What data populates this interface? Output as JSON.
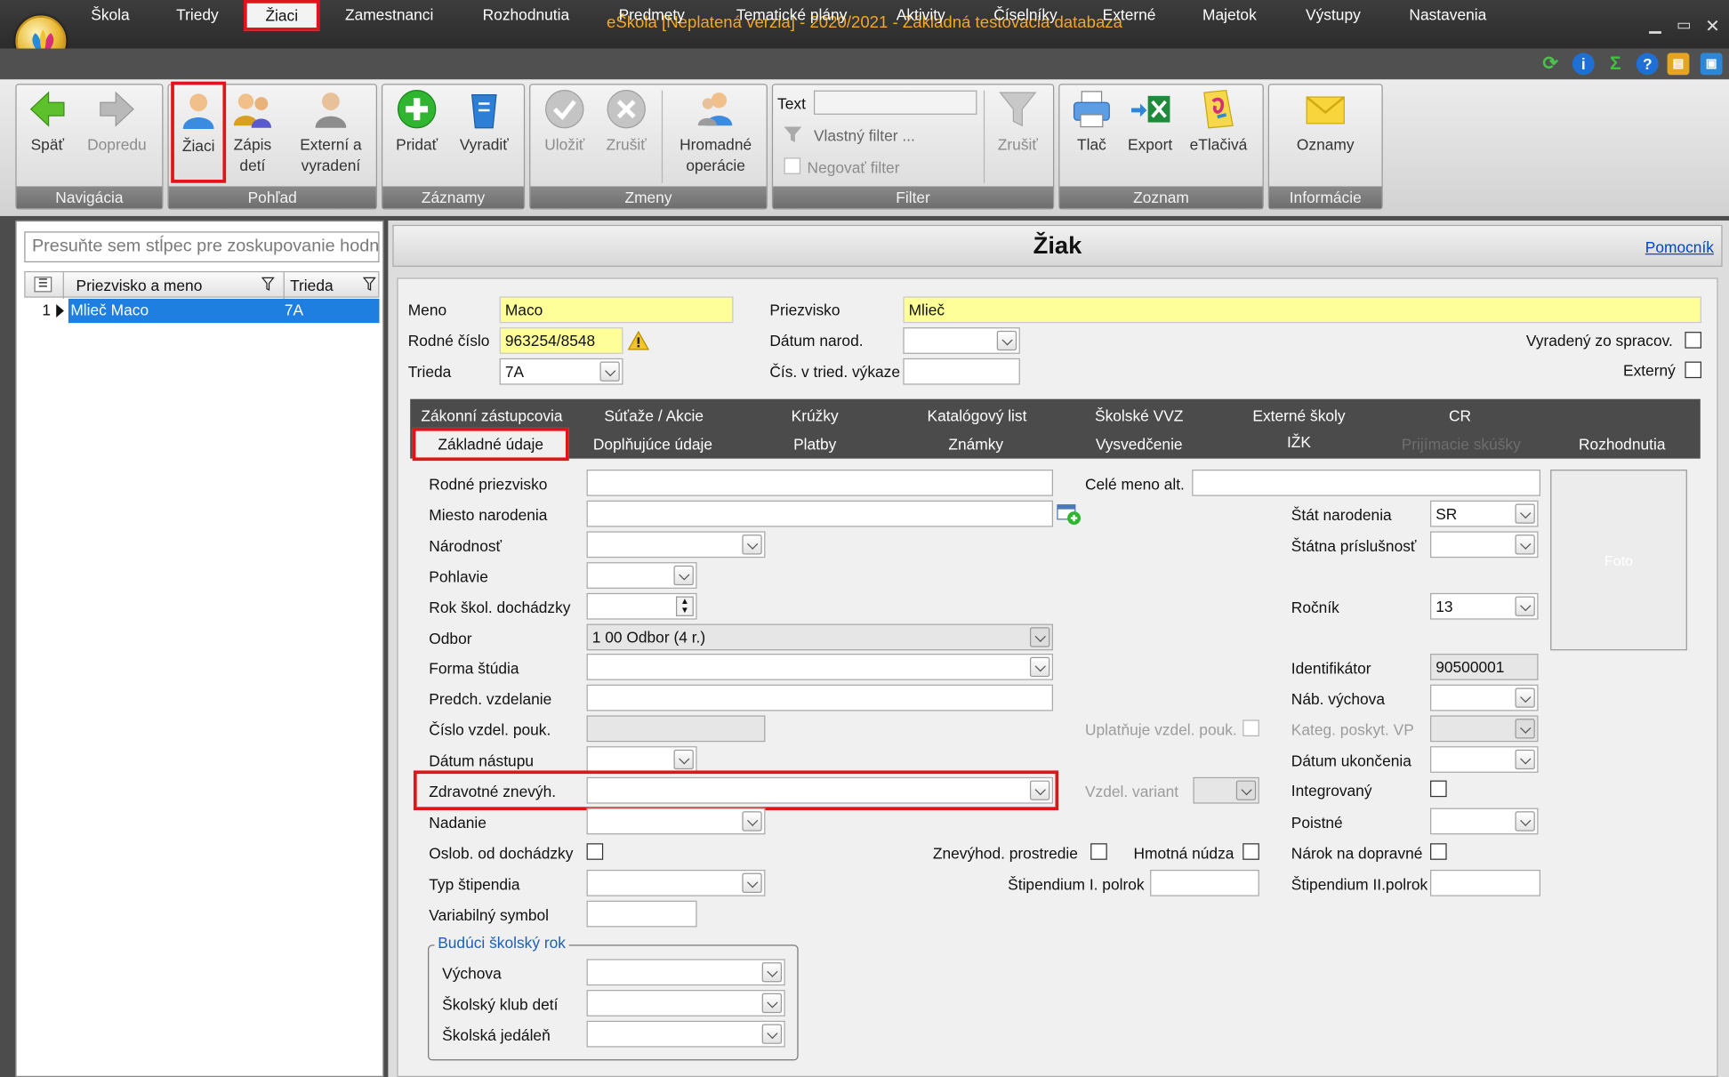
{
  "window": {
    "title": "eŠkola [Neplatená verzia] - 2020/2021 - Základná testovacia databaza"
  },
  "menu": [
    "Škola",
    "Triedy",
    "Žiaci",
    "Zamestnanci",
    "Rozhodnutia",
    "Predmety",
    "Tematické plány",
    "Aktivity",
    "Číselníky",
    "Externé",
    "Majetok",
    "Výstupy",
    "Nastavenia"
  ],
  "ribbon": {
    "nav": {
      "back": "Späť",
      "forward": "Dopredu",
      "group": "Navigácia"
    },
    "view": {
      "students": "Žiaci",
      "enroll_line1": "Zápis",
      "enroll_line2": "detí",
      "ext_line1": "Externí a",
      "ext_line2": "vyradení",
      "group": "Pohľad"
    },
    "records": {
      "add": "Pridať",
      "discard": "Vyradiť",
      "group": "Záznamy"
    },
    "changes": {
      "save": "Uložiť",
      "cancel": "Zrušiť",
      "bulk_line1": "Hromadné",
      "bulk_line2": "operácie",
      "group": "Zmeny"
    },
    "filter": {
      "text_label": "Text",
      "custom": "Vlastný filter ...",
      "negate": "Negovať filter",
      "clear": "Zrušiť",
      "group": "Filter"
    },
    "list": {
      "print": "Tlač",
      "export": "Export",
      "eprint": "eTlačivá",
      "group": "Zoznam"
    },
    "info": {
      "announce": "Oznamy",
      "group": "Informácie"
    }
  },
  "grid": {
    "group_hint": "Presuňte sem stĺpec pre zoskupovanie hodnôt",
    "col_name": "Priezvisko a meno",
    "col_class": "Trieda",
    "rows": [
      {
        "num": "1",
        "name": "Mlieč Maco",
        "class": "7A"
      }
    ]
  },
  "detail": {
    "title": "Žiak",
    "help": "Pomocník",
    "meno_label": "Meno",
    "meno": "Maco",
    "priezvisko_label": "Priezvisko",
    "priezvisko": "Mlieč",
    "rc_label": "Rodné číslo",
    "rc": "963254/8548",
    "datum_label": "Dátum narod.",
    "trieda_label": "Trieda",
    "trieda": "7A",
    "cis_label": "Čís. v tried. výkaze",
    "vyradeny_label": "Vyradený zo spracov.",
    "externy_label": "Externý"
  },
  "tabs_row1": [
    "Zákonní zástupcovia",
    "Súťaže / Akcie",
    "Krúžky",
    "Katalógový list",
    "Školské VVZ",
    "Externé školy",
    "CR"
  ],
  "tabs_row2": [
    "Základné údaje",
    "Doplňujúce údaje",
    "Platby",
    "Známky",
    "Vysvedčenie",
    "IŽK",
    "Prijímacie skúšky",
    "Rozhodnutia"
  ],
  "basic": {
    "rodne_priezvisko": "Rodné priezvisko",
    "cele_meno_alt": "Celé meno alt.",
    "miesto_narodenia": "Miesto narodenia",
    "stat_narodenia": "Štát narodenia",
    "stat_narodenia_val": "SR",
    "narodnost": "Národnosť",
    "statna_prislusnost": "Štátna príslušnosť",
    "pohlavie": "Pohlavie",
    "rok_skol": "Rok škol. dochádzky",
    "rocnik": "Ročník",
    "rocnik_val": "13",
    "odbor": "Odbor",
    "odbor_val": "1 00 Odbor (4 r.)",
    "forma": "Forma štúdia",
    "identifikator": "Identifikátor",
    "identifikator_val": "90500001",
    "predch": "Predch. vzdelanie",
    "nab_vychova": "Náb. výchova",
    "cislo_pouk": "Číslo vzdel. pouk.",
    "uplatnuje": "Uplatňuje vzdel. pouk.",
    "kateg": "Kateg. poskyt. VP",
    "datum_nastupu": "Dátum nástupu",
    "datum_ukoncenia": "Dátum ukončenia",
    "zdravotne": "Zdravotné znevýh.",
    "vzdel_variant": "Vzdel. variant",
    "integrovany": "Integrovaný",
    "nadanie": "Nadanie",
    "poistne": "Poistné",
    "oslob": "Oslob. od dochádzky",
    "znevyhod_prostredie": "Znevýhod. prostredie",
    "hmotna_nudza": "Hmotná núdza",
    "narok": "Nárok na dopravné",
    "typ_stipendia": "Typ štipendia",
    "stip1": "Štipendium I. polrok",
    "stip2": "Štipendium II.polrok",
    "var_symbol": "Variabilný symbol",
    "foto": "Foto"
  },
  "future_year": {
    "legend": "Budúci školský rok",
    "vychova": "Výchova",
    "klub": "Školský klub detí",
    "jedalen": "Školská jedáleň"
  },
  "colors": {
    "accent_red": "#e0151b",
    "title_orange": "#f5a623",
    "selection_blue": "#1e7fe0",
    "highlight_yellow": "#ffff99"
  }
}
